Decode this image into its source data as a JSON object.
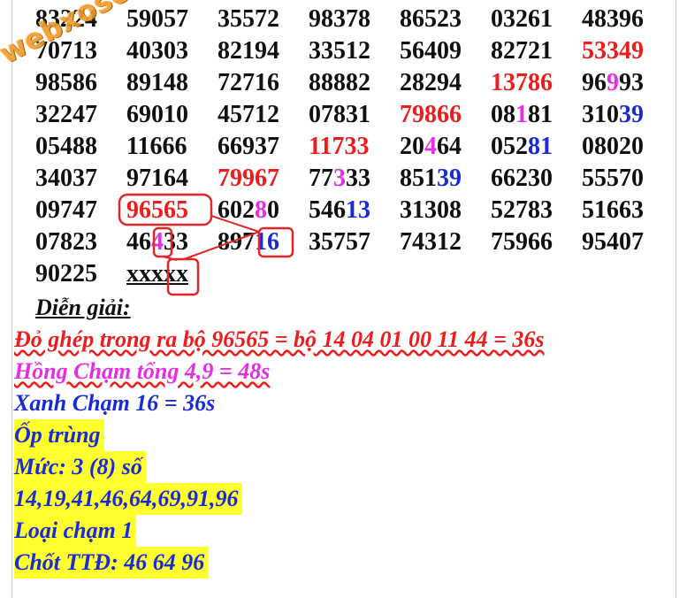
{
  "watermark": "webxoso.net",
  "rows": [
    [
      "83224",
      "59057",
      "35572",
      "98378",
      "86523",
      "03261",
      "48396"
    ],
    [
      "70713",
      "40303",
      "82194",
      "33512",
      "56409",
      "82721",
      "53349"
    ],
    [
      "98586",
      "89148",
      "72716",
      "88882",
      "28294",
      "13786",
      "96993"
    ],
    [
      "32247",
      "69010",
      "45712",
      "07831",
      "79866",
      "08181",
      "31039"
    ],
    [
      "05488",
      "11666",
      "66937",
      "11733",
      "20464",
      "05281",
      "08020"
    ],
    [
      "34037",
      "97164",
      "79967",
      "77333",
      "85139",
      "66230",
      "55570"
    ],
    [
      "09747",
      "96565",
      "60280",
      "54613",
      "31308",
      "52783",
      "51663"
    ],
    [
      "07823",
      "46433",
      "89716",
      "35757",
      "74312",
      "75966",
      "95407"
    ],
    [
      "90225",
      "xxxxx"
    ]
  ],
  "notes": {
    "heading": "Diễn giải:",
    "line1": "Đỏ ghép trong ra bộ 96565 = bộ 14 04 01 00 11 44 = 36s",
    "line2": "Hồng Chạm tổng 4,9 = 48s",
    "line3": "Xanh Chạm 16 = 36s",
    "line4": "Ốp trùng",
    "line5": "Mức: 3 (8) số",
    "line6": "14,19,41,46,64,69,91,96",
    "line7": "Loại chạm 1",
    "line8": "Chốt TTĐ: 46 64 96"
  },
  "colors": {
    "red": "#ee1c1c",
    "magenta": "#e62ee6",
    "blue": "#1a2bd6",
    "highlight": "#ffff2e",
    "watermark": "#f39b28"
  }
}
